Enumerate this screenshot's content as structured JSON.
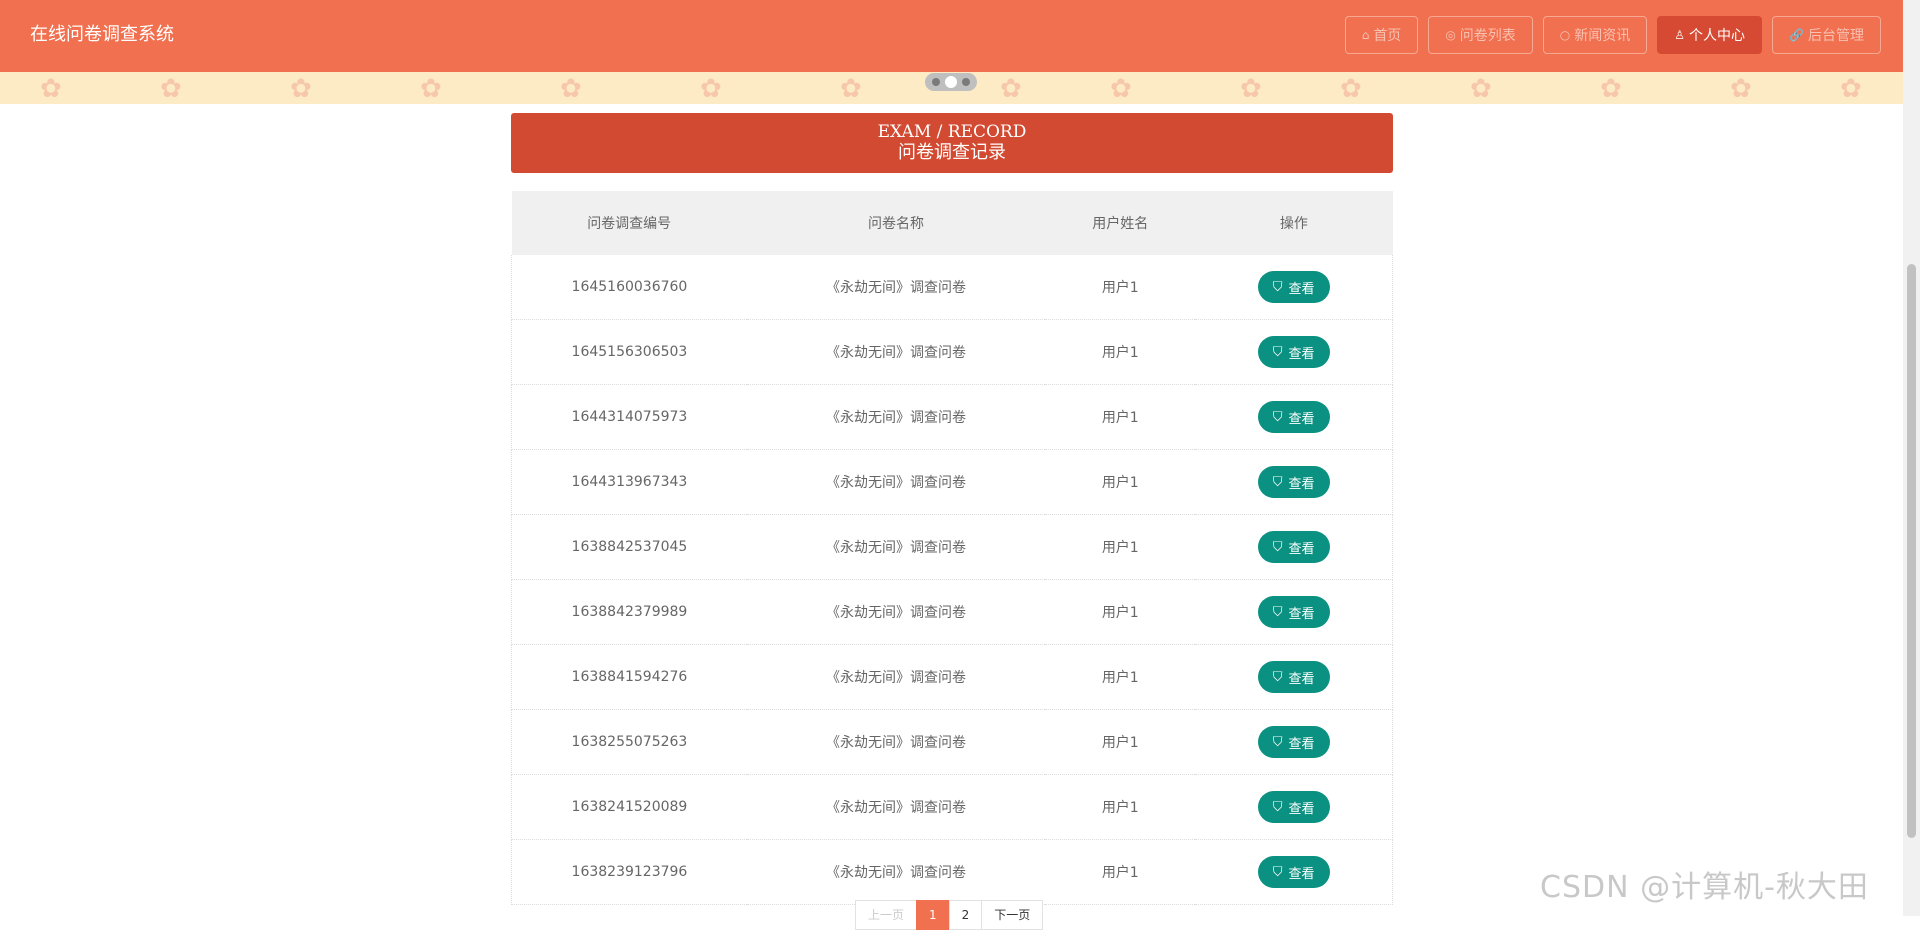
{
  "header": {
    "brand": "在线问卷调查系统",
    "nav": [
      {
        "icon": "home-icon",
        "glyph": "⌂",
        "label": "首页",
        "active": false
      },
      {
        "icon": "list-icon",
        "glyph": "◎",
        "label": "问卷列表",
        "active": false
      },
      {
        "icon": "news-icon",
        "glyph": "○",
        "label": "新闻资讯",
        "active": false
      },
      {
        "icon": "user-icon",
        "glyph": "♙",
        "label": "个人中心",
        "active": true
      },
      {
        "icon": "link-icon",
        "glyph": "🔗",
        "label": "后台管理",
        "active": false
      }
    ]
  },
  "section": {
    "title_en": "EXAM / RECORD",
    "title_cn": "问卷调查记录"
  },
  "table": {
    "headers": [
      "问卷调查编号",
      "问卷名称",
      "用户姓名",
      "操作"
    ],
    "action_label": "查看",
    "rows": [
      {
        "id": "1645160036760",
        "name": "《永劫无间》调查问卷",
        "user": "用户1"
      },
      {
        "id": "1645156306503",
        "name": "《永劫无间》调查问卷",
        "user": "用户1"
      },
      {
        "id": "1644314075973",
        "name": "《永劫无间》调查问卷",
        "user": "用户1"
      },
      {
        "id": "1644313967343",
        "name": "《永劫无间》调查问卷",
        "user": "用户1"
      },
      {
        "id": "1638842537045",
        "name": "《永劫无间》调查问卷",
        "user": "用户1"
      },
      {
        "id": "1638842379989",
        "name": "《永劫无间》调查问卷",
        "user": "用户1"
      },
      {
        "id": "1638841594276",
        "name": "《永劫无间》调查问卷",
        "user": "用户1"
      },
      {
        "id": "1638255075263",
        "name": "《永劫无间》调查问卷",
        "user": "用户1"
      },
      {
        "id": "1638241520089",
        "name": "《永劫无间》调查问卷",
        "user": "用户1"
      },
      {
        "id": "1638239123796",
        "name": "《永劫无间》调查问卷",
        "user": "用户1"
      }
    ]
  },
  "pagination": {
    "prev": "上一页",
    "pages": [
      "1",
      "2"
    ],
    "current": "1",
    "next": "下一页"
  },
  "watermark": "CSDN @计算机-秋大田",
  "colors": {
    "topbar": "#f07050",
    "section_header": "#d24a31",
    "action_button": "#0b9181"
  }
}
